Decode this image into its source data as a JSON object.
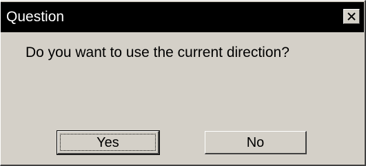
{
  "dialog": {
    "title": "Question",
    "message": "Do you want to use the current direction?",
    "buttons": {
      "yes_label": "Yes",
      "no_label": "No"
    },
    "close_icon": "close-icon"
  },
  "colors": {
    "titlebar": "#000000",
    "title_text": "#ffffff",
    "face": "#d4d0c8"
  }
}
